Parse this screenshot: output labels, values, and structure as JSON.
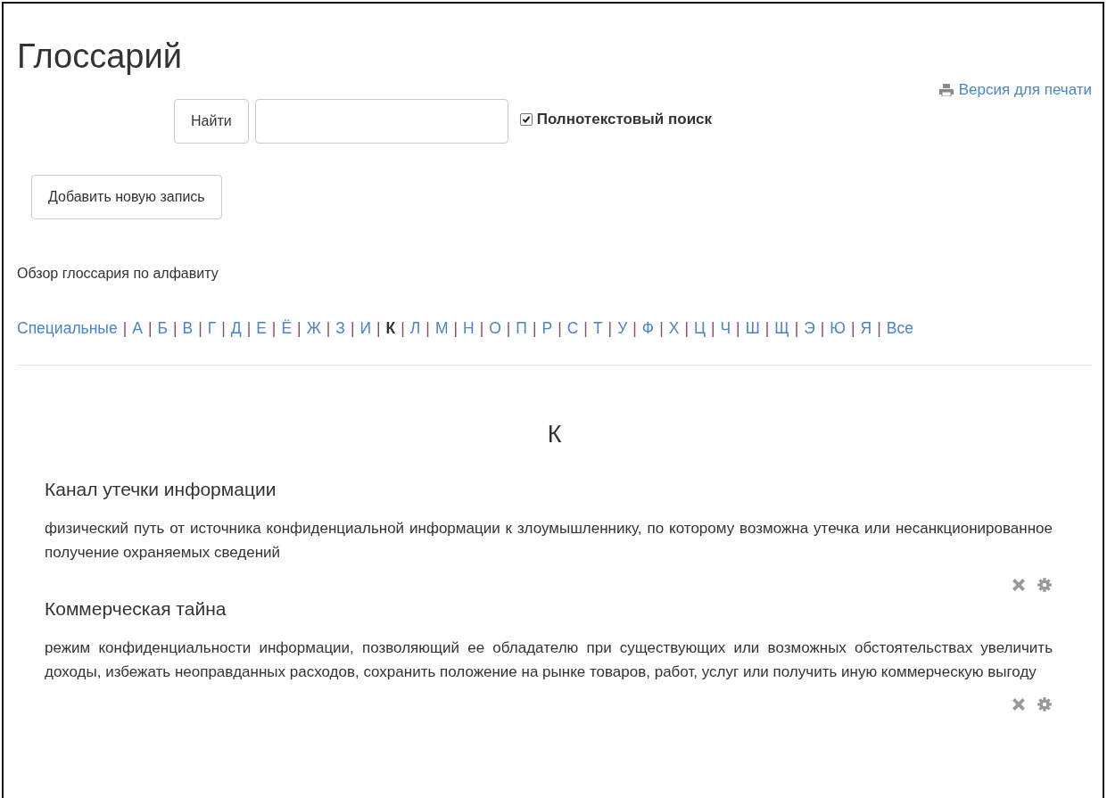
{
  "title": "Глоссарий",
  "print_link": "Версия для печати",
  "search": {
    "button": "Найти",
    "fulltext": {
      "label": "Полнотекстовый поиск",
      "checked": true
    }
  },
  "add_button": "Добавить новую запись",
  "browse_label": "Обзор глоссария по алфавиту",
  "alphabet": {
    "separator": "|",
    "items": [
      {
        "label": "Специальные",
        "selected": false
      },
      {
        "label": "А",
        "selected": false
      },
      {
        "label": "Б",
        "selected": false
      },
      {
        "label": "В",
        "selected": false
      },
      {
        "label": "Г",
        "selected": false
      },
      {
        "label": "Д",
        "selected": false
      },
      {
        "label": "Е",
        "selected": false
      },
      {
        "label": "Ё",
        "selected": false
      },
      {
        "label": "Ж",
        "selected": false
      },
      {
        "label": "З",
        "selected": false
      },
      {
        "label": "И",
        "selected": false
      },
      {
        "label": "К",
        "selected": true
      },
      {
        "label": "Л",
        "selected": false
      },
      {
        "label": "М",
        "selected": false
      },
      {
        "label": "Н",
        "selected": false
      },
      {
        "label": "О",
        "selected": false
      },
      {
        "label": "П",
        "selected": false
      },
      {
        "label": "Р",
        "selected": false
      },
      {
        "label": "С",
        "selected": false
      },
      {
        "label": "Т",
        "selected": false
      },
      {
        "label": "У",
        "selected": false
      },
      {
        "label": "Ф",
        "selected": false
      },
      {
        "label": "Х",
        "selected": false
      },
      {
        "label": "Ц",
        "selected": false
      },
      {
        "label": "Ч",
        "selected": false
      },
      {
        "label": "Ш",
        "selected": false
      },
      {
        "label": "Щ",
        "selected": false
      },
      {
        "label": "Э",
        "selected": false
      },
      {
        "label": "Ю",
        "selected": false
      },
      {
        "label": "Я",
        "selected": false
      },
      {
        "label": "Все",
        "selected": false
      }
    ]
  },
  "letter_heading": "К",
  "entries": [
    {
      "term": "Канал утечки информации",
      "definition": "физический путь от источника конфиденциальной информации к злоумышленнику, по которому возможна утечка или несанкционированное получение охраняемых сведений"
    },
    {
      "term": "Коммерческая тайна",
      "definition": "режим конфиденциальности информации, позволяющий ее обладателю при существующих или возможных обстоятельствах увеличить доходы, избежать неоправданных расходов, сохранить положение на рынке товаров, работ, услуг или получить иную коммерческую выгоду"
    }
  ]
}
